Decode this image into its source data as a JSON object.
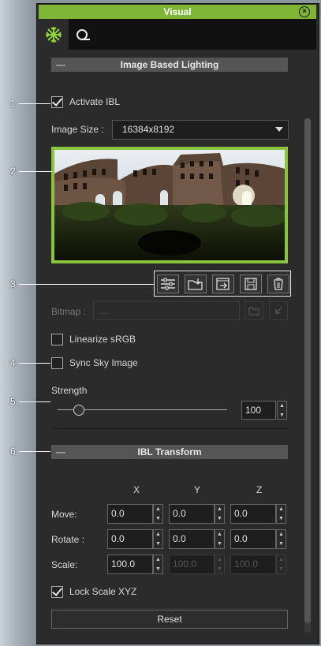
{
  "window": {
    "title": "Visual"
  },
  "tabs": [
    {
      "icon": "snowflake-icon"
    },
    {
      "icon": "environment-icon"
    }
  ],
  "ibl": {
    "header": "Image Based Lighting",
    "activate_label": "Activate IBL",
    "activate_checked": true,
    "image_size_label": "Image Size :",
    "image_size_value": "16384x8192",
    "bitmap_label": "Bitmap :",
    "bitmap_value": "...",
    "linearize_label": "Linearize sRGB",
    "linearize_checked": false,
    "sync_label": "Sync Sky Image",
    "sync_checked": false,
    "strength_label": "Strength",
    "strength_value": "100",
    "strength_fraction": 0.12
  },
  "toolbar": {
    "icons": [
      "settings-sliders-icon",
      "load-folder-icon",
      "export-icon",
      "save-icon",
      "delete-icon"
    ]
  },
  "transform": {
    "header": "IBL Transform",
    "col_x": "X",
    "col_y": "Y",
    "col_z": "Z",
    "move_label": "Move:",
    "rotate_label": "Rotate :",
    "scale_label": "Scale:",
    "move": [
      "0.0",
      "0.0",
      "0.0"
    ],
    "rotate": [
      "0.0",
      "0.0",
      "0.0"
    ],
    "scale": [
      "100.0",
      "100.0",
      "100.0"
    ],
    "lock_label": "Lock Scale XYZ",
    "lock_checked": true,
    "reset_label": "Reset"
  },
  "callouts": [
    "1",
    "2",
    "3",
    "4",
    "5",
    "6"
  ],
  "colors": {
    "accent": "#7fb535",
    "panel": "#2b2b2b",
    "header": "#555555"
  }
}
